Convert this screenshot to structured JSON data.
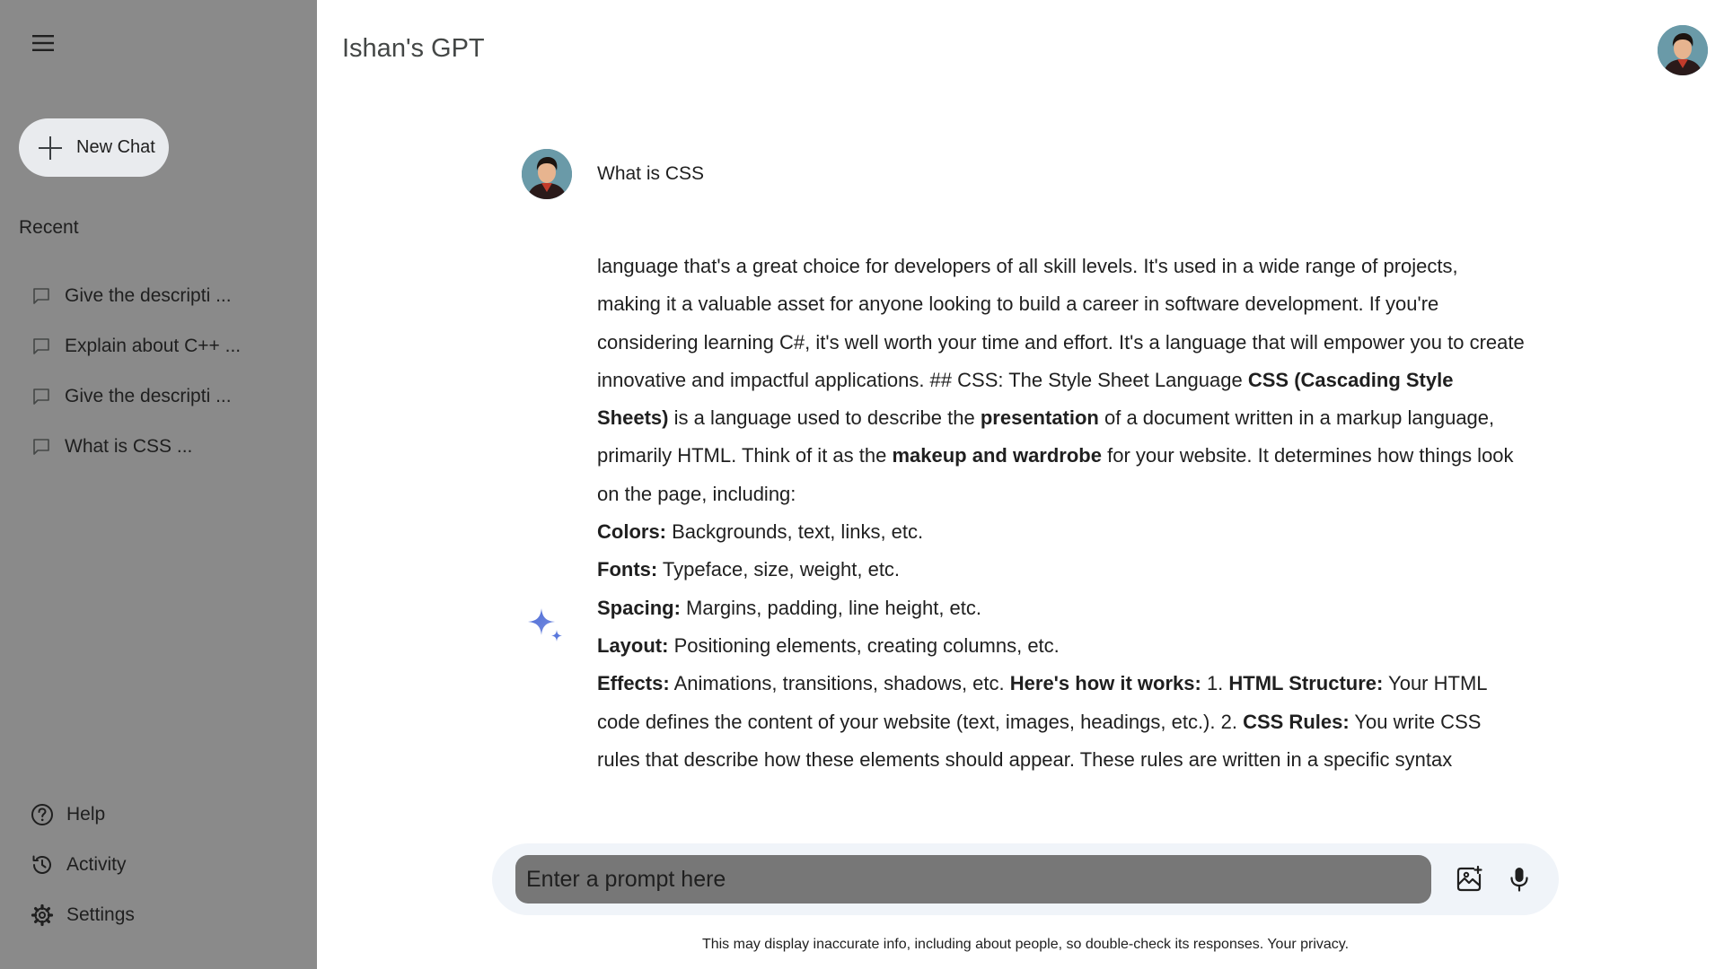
{
  "app": {
    "title": "Ishan's GPT"
  },
  "sidebar": {
    "menu_icon": "hamburger-menu-icon",
    "new_chat_label": "New Chat",
    "recent_label": "Recent",
    "recent_items": [
      {
        "label": "Give the descripti ..."
      },
      {
        "label": "Explain about C++ ..."
      },
      {
        "label": "Give the descripti ..."
      },
      {
        "label": "What is CSS ..."
      }
    ],
    "bottom_items": [
      {
        "label": "Help",
        "icon": "help-circle-icon"
      },
      {
        "label": "Activity",
        "icon": "history-icon"
      },
      {
        "label": "Settings",
        "icon": "gear-icon"
      }
    ]
  },
  "conversation": {
    "user_prompt": "What is CSS",
    "response": {
      "p1": "language that's a great choice for developers of all skill levels. It's used in a wide range of projects, making it a valuable asset for anyone looking to build a career in software development. If you're considering learning C#, it's well worth your time and effort. It's a language that will empower you to create innovative and impactful applications. ## CSS: The Style Sheet Language ",
      "b1": "CSS (Cascading Style Sheets)",
      "p2": " is a language used to describe the ",
      "b2": "presentation",
      "p3": " of a document written in a markup language, primarily HTML. Think of it as the ",
      "b3": "makeup and wardrobe",
      "p4": " for your website. It determines how things look on the page, including:",
      "list": [
        {
          "term": "Colors:",
          "desc": " Backgrounds, text, links, etc."
        },
        {
          "term": "Fonts:",
          "desc": " Typeface, size, weight, etc."
        },
        {
          "term": "Spacing:",
          "desc": " Margins, padding, line height, etc."
        },
        {
          "term": "Layout:",
          "desc": " Positioning elements, creating columns, etc."
        }
      ],
      "effects_term": "Effects:",
      "effects_desc": " Animations, transitions, shadows, etc. ",
      "how_term": "Here's how it works:",
      "step1_prefix": " 1. ",
      "step1_term": "HTML Structure:",
      "step1_desc": " Your HTML code defines the content of your website (text, images, headings, etc.). 2. ",
      "step2_term": "CSS Rules:",
      "step2_desc": " You write CSS rules that describe how these elements should appear. These rules are written in a specific syntax"
    }
  },
  "input": {
    "placeholder": "Enter a prompt here",
    "value": ""
  },
  "footer": {
    "disclaimer": "This may display inaccurate info, including about people, so double-check its responses.",
    "privacy_link": "Your privacy."
  },
  "colors": {
    "sidebar_bg": "#8a8a8a",
    "new_chat_bg": "#e9ebee",
    "input_bar_bg": "#f0f4f9",
    "input_field_bg": "#777777",
    "gem_blue": "#4b6bd6"
  }
}
